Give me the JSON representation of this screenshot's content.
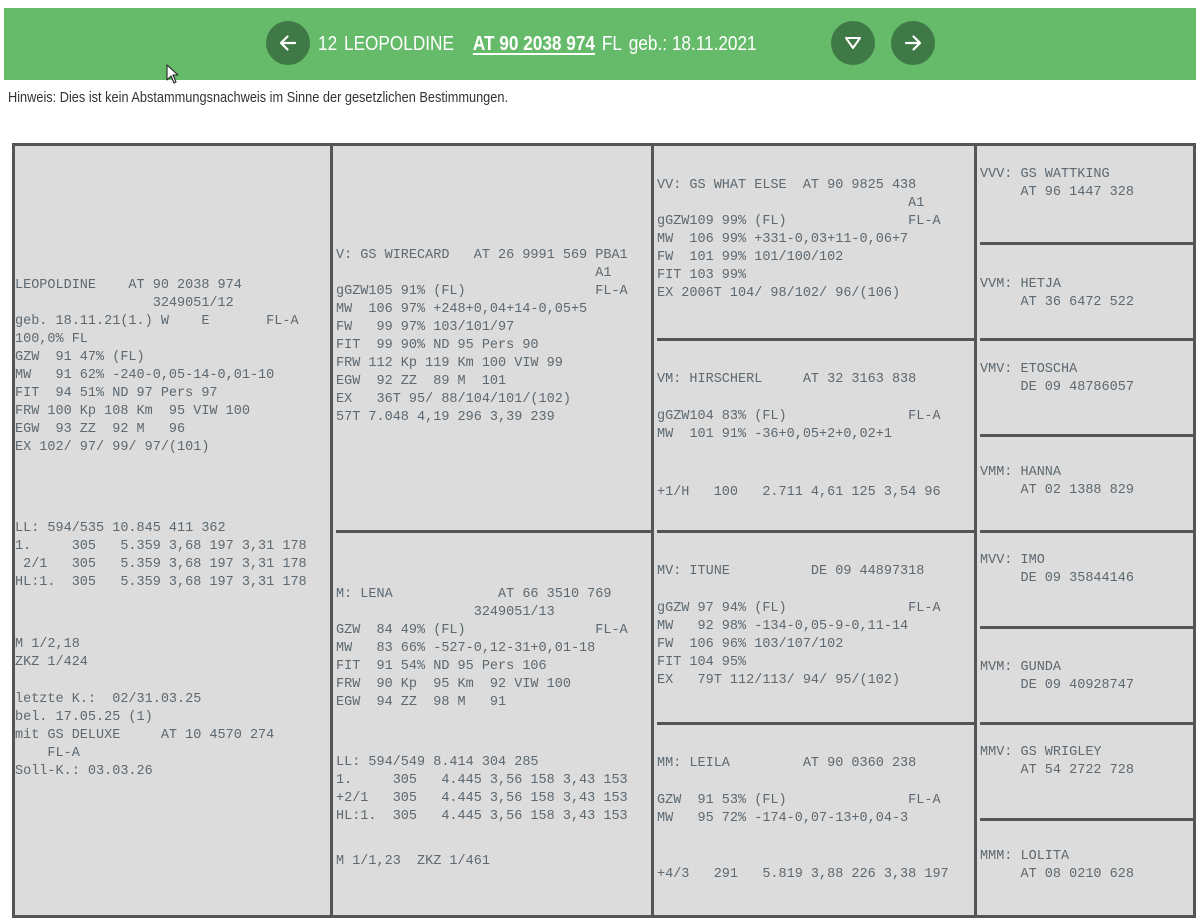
{
  "header": {
    "number": "12",
    "name": "LEOPOLDINE",
    "ear_tag": "AT 90 2038 974",
    "breed": "FL",
    "born": "geb.: 18.11.2021",
    "icons": {
      "prev": "arrow-left-icon",
      "toggle": "triangle-down-icon",
      "next": "arrow-right-icon"
    },
    "accent_color": "#66bb6a",
    "button_color": "#3f7a46"
  },
  "hint": "Hinweis: Dies ist kein Abstammungsnachweis im Sinne der gesetzlichen Bestimmungen.",
  "animal": {
    "block1": "LEOPOLDINE    AT 90 2038 974\n                 3249051/12\ngeb. 18.11.21(1.) W    E       FL-A\n100,0% FL\nGZW  91 47% (FL)\nMW   91 62% -240-0,05-14-0,01-10\nFIT  94 51% ND 97 Pers 97\nFRW 100 Kp 108 Km  95 VIW 100\nEGW  93 ZZ  92 M   96\nEX 102/ 97/ 99/ 97/(101)",
    "block2": "LL: 594/535 10.845 411 362\n1.     305   5.359 3,68 197 3,31 178\n 2/1   305   5.359 3,68 197 3,31 178\nHL:1.  305   5.359 3,68 197 3,31 178",
    "block3": "M 1/2,18\nZKZ 1/424",
    "block4": "letzte K.:  02/31.03.25\nbel. 17.05.25 (1)\nmit GS DELUXE     AT 10 4570 274\n    FL-A\nSoll-K.: 03.03.26"
  },
  "sire": {
    "block1": "V: GS WIRECARD   AT 26 9991 569 PBA1\n                                A1\ngGZW105 91% (FL)                FL-A\nMW  106 97% +248+0,04+14-0,05+5\nFW   99 97% 103/101/97\nFIT  99 90% ND 95 Pers 90\nFRW 112 Kp 119 Km 100 VIW 99\nEGW  92 ZZ  89 M  101\nEX   36T 95/ 88/104/101/(102)\n57T 7.048 4,19 296 3,39 239"
  },
  "dam": {
    "block1": "M: LENA             AT 66 3510 769\n                 3249051/13\nGZW  84 49% (FL)                FL-A\nMW   83 66% -527-0,12-31+0,01-18\nFIT  91 54% ND 95 Pers 106\nFRW  90 Kp  95 Km  92 VIW 100\nEGW  94 ZZ  98 M   91",
    "block2": "LL: 594/549 8.414 304 285\n1.     305   4.445 3,56 158 3,43 153\n+2/1   305   4.445 3,56 158 3,43 153\nHL:1.  305   4.445 3,56 158 3,43 153",
    "block3": "M 1/1,23  ZKZ 1/461"
  },
  "vv": {
    "block1": "VV: GS WHAT ELSE  AT 90 9825 438\n                               A1\ngGZW109 99% (FL)               FL-A\nMW  106 99% +331-0,03+11-0,06+7\nFW  101 99% 101/100/102\nFIT 103 99%\nEX 2006T 104/ 98/102/ 96/(106)"
  },
  "vm": {
    "block1": "VM: HIRSCHERL     AT 32 3163 838",
    "block2": "gGZW104 83% (FL)               FL-A\nMW  101 91% -36+0,05+2+0,02+1",
    "block3": "+1/H   100   2.711 4,61 125 3,54 96"
  },
  "mv": {
    "block1": "MV: ITUNE          DE 09 44897318",
    "block2": "gGZW 97 94% (FL)               FL-A\nMW   92 98% -134-0,05-9-0,11-14\nFW  106 96% 103/107/102\nFIT 104 95%\nEX   79T 112/113/ 94/ 95/(102)"
  },
  "mm": {
    "block1": "MM: LEILA         AT 90 0360 238",
    "block2": "GZW  91 53% (FL)               FL-A\nMW   95 72% -174-0,07-13+0,04-3",
    "block3": "+4/3   291   5.819 3,88 226 3,38 197"
  },
  "gen4": {
    "vvv": "VVV: GS WATTKING\n     AT 96 1447 328",
    "vvm": "VVM: HETJA\n     AT 36 6472 522",
    "vmv": "VMV: ETOSCHA\n     DE 09 48786057",
    "vmm": "VMM: HANNA\n     AT 02 1388 829",
    "mvv": "MVV: IMO\n     DE 09 35844146",
    "mvm": "MVM: GUNDA\n     DE 09 40928747",
    "mmv": "MMV: GS WRIGLEY\n     AT 54 2722 728",
    "mmm": "MMM: LOLITA\n     AT 08 0210 628"
  }
}
